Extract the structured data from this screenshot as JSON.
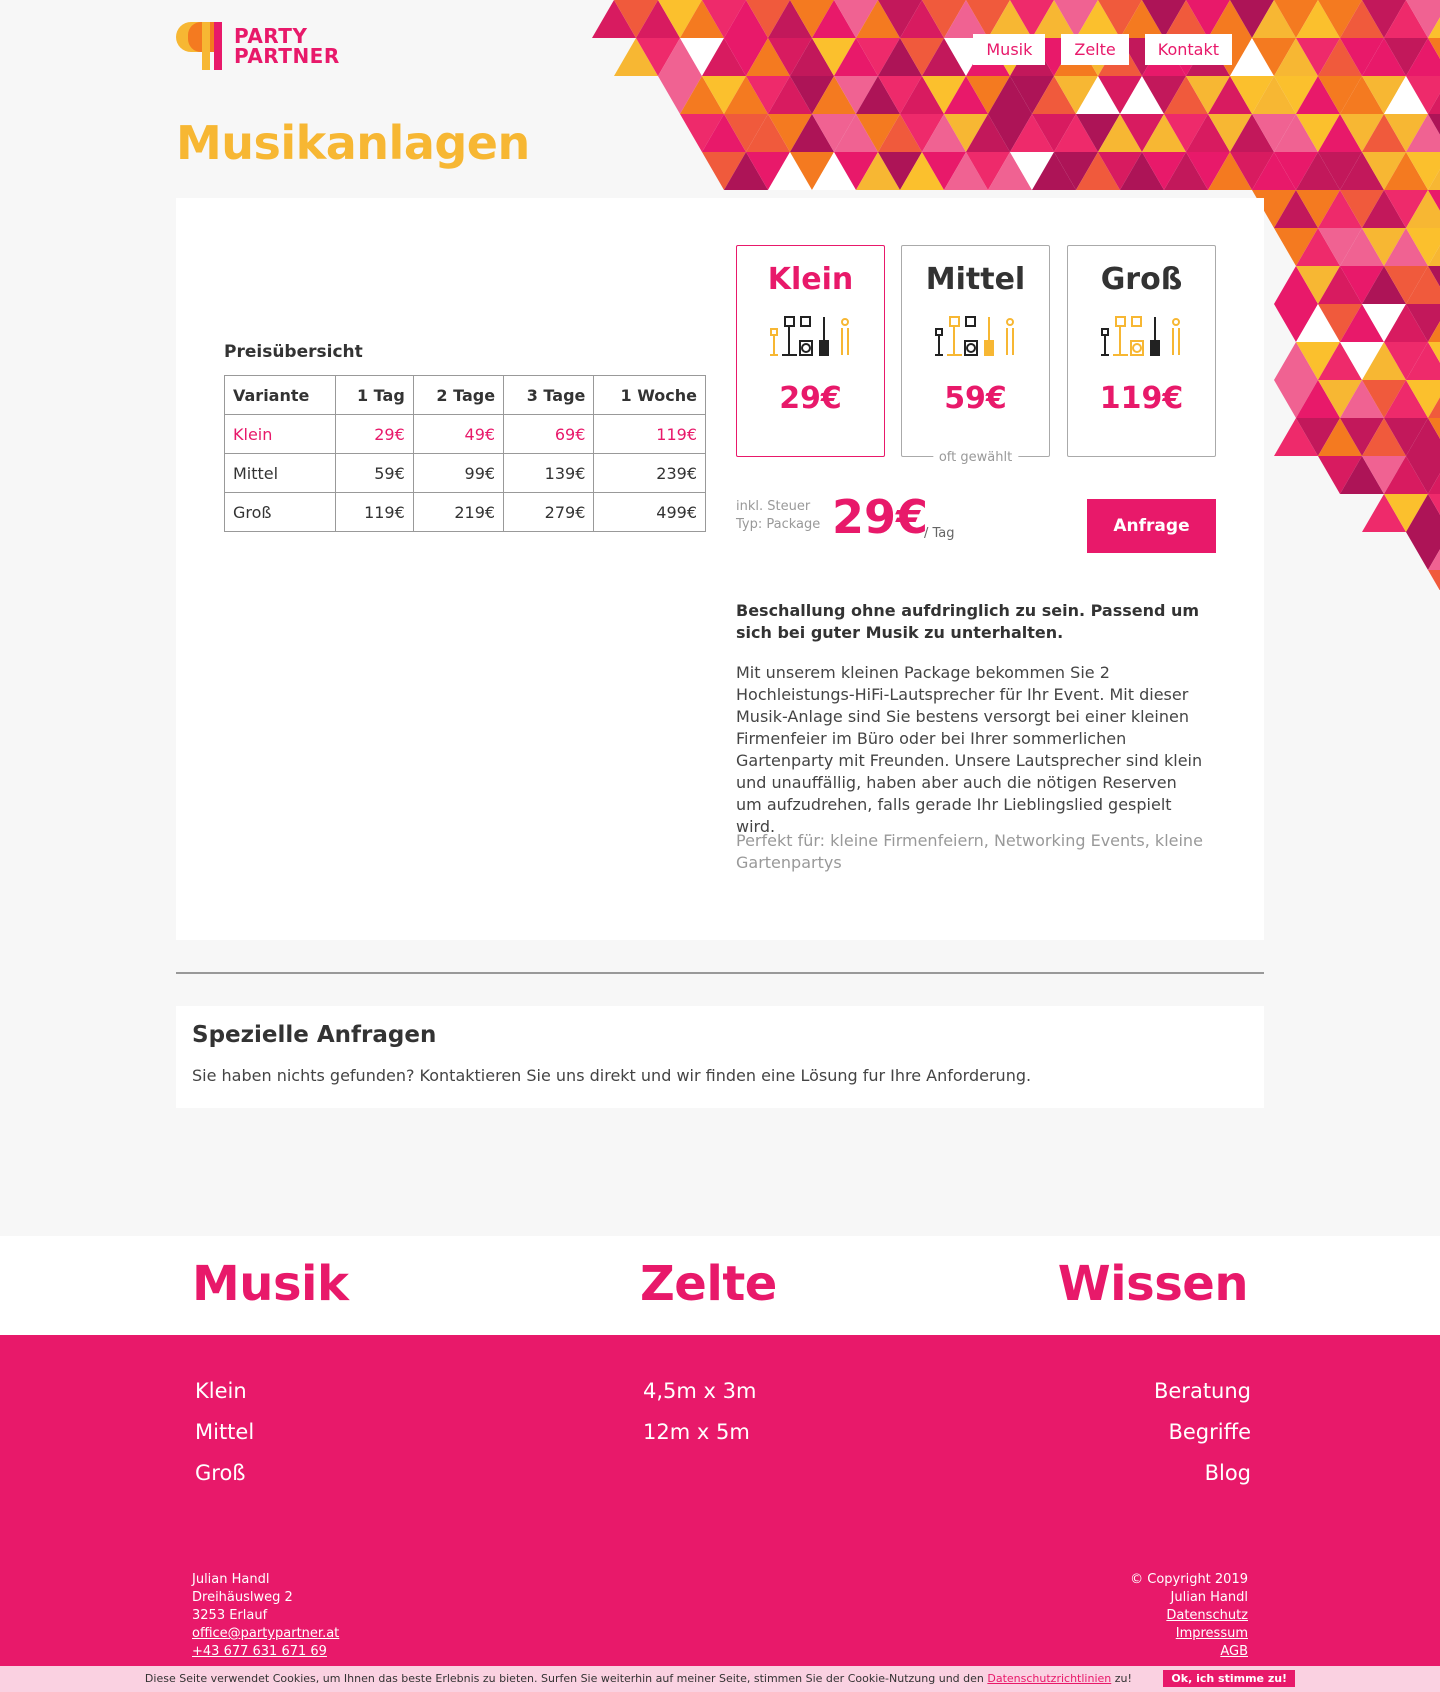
{
  "brand": {
    "line1": "PARTY",
    "line2": "PARTNER"
  },
  "nav": [
    {
      "label": "Musik"
    },
    {
      "label": "Zelte"
    },
    {
      "label": "Kontakt"
    }
  ],
  "page_title": "Musikanlagen",
  "price_table": {
    "caption": "Preisübersicht",
    "headers": [
      "Variante",
      "1 Tag",
      "2 Tage",
      "3 Tage",
      "1 Woche"
    ],
    "rows": [
      [
        "Klein",
        "29€",
        "49€",
        "69€",
        "119€"
      ],
      [
        "Mittel",
        "59€",
        "99€",
        "139€",
        "239€"
      ],
      [
        "Groß",
        "119€",
        "219€",
        "279€",
        "499€"
      ]
    ]
  },
  "packages": [
    {
      "name": "Klein",
      "price": "29€",
      "note": ""
    },
    {
      "name": "Mittel",
      "price": "59€",
      "note": "oft gewählt"
    },
    {
      "name": "Groß",
      "price": "119€",
      "note": ""
    }
  ],
  "selected": {
    "tax_label": "inkl. Steuer",
    "type_label": "Typ: Package",
    "price": "29€",
    "unit": "/ Tag",
    "button": "Anfrage"
  },
  "description": {
    "headline": "Beschallung ohne aufdringlich zu sein. Passend um sich bei guter Musik zu unterhalten.",
    "body": "Mit unserem kleinen Package bekommen Sie 2 Hochleistungs-HiFi-Lautsprecher für Ihr Event. Mit dieser Musik-Anlage sind Sie bestens versorgt bei einer kleinen Firmenfeier im Büro oder bei Ihrer sommerlichen Gartenparty mit Freunden. Unsere Lautsprecher sind klein und unauffällig, haben aber auch die nötigen Reserven um aufzudrehen, falls gerade Ihr Lieblingslied gespielt wird.",
    "perfect_for": "Perfekt für: kleine Firmenfeiern, Networking Events, kleine Gartenpartys"
  },
  "special": {
    "title": "Spezielle Anfragen",
    "text": "Sie haben nichts gefunden? Kontaktieren Sie uns direkt und wir finden eine Lösung fur Ihre Anforderung."
  },
  "footer": {
    "headings": [
      "Musik",
      "Zelte",
      "Wissen"
    ],
    "musik_links": [
      "Klein",
      "Mittel",
      "Groß"
    ],
    "zelte_links": [
      "4,5m x 3m",
      "12m x 5m"
    ],
    "wissen_links": [
      "Beratung",
      "Begriffe",
      "Blog"
    ],
    "address": {
      "name": "Julian Handl",
      "street": "Dreihäuslweg 2",
      "city": "3253 Erlauf",
      "email": "office@partypartner.at",
      "phone": "+43 677 631 671 69"
    },
    "legal": {
      "copyright": "© Copyright 2019",
      "owner": "Julian Handl",
      "privacy": "Datenschutz",
      "imprint": "Impressum",
      "terms": "AGB"
    }
  },
  "cookie": {
    "text": "Diese Seite verwendet Cookies, um Ihnen das beste Erlebnis zu bieten. Surfen Sie weiterhin auf meiner Seite, stimmen Sie der Cookie-Nutzung und den",
    "link": "Datenschutzrichtlinien",
    "suffix": "zu!",
    "button": "Ok, ich stimme zu!"
  },
  "colors": {
    "accent": "#e8196a",
    "title_yellow": "#f7b733",
    "orange": "#f47a20",
    "background": "#f7f7f7"
  }
}
